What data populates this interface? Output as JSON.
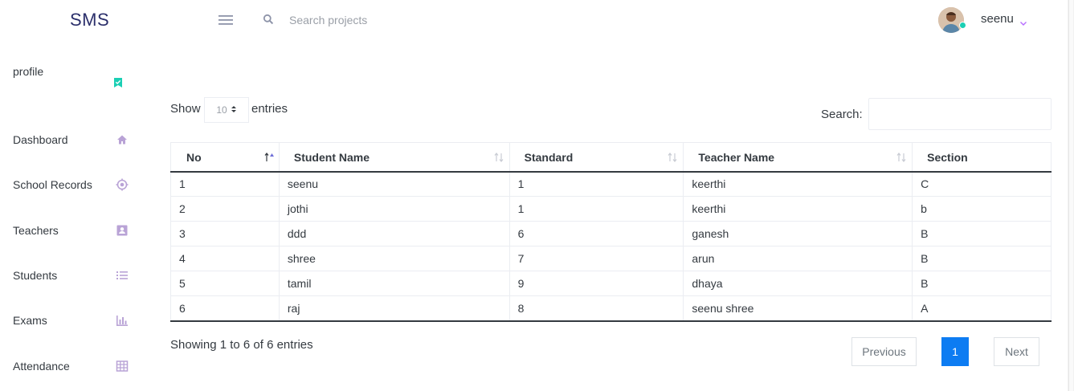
{
  "sidebar": {
    "brand": "SMS",
    "profile": "profile",
    "items": [
      {
        "label": "Dashboard",
        "icon": "home-icon"
      },
      {
        "label": "School Records",
        "icon": "crosshair-icon"
      },
      {
        "label": "Teachers",
        "icon": "contact-card-icon"
      },
      {
        "label": "Students",
        "icon": "list-icon"
      },
      {
        "label": "Exams",
        "icon": "bar-chart-icon"
      },
      {
        "label": "Attendance",
        "icon": "grid-table-icon"
      }
    ]
  },
  "navbar": {
    "search_placeholder": "Search projects",
    "username": "seenu"
  },
  "datatable": {
    "show_label": "Show",
    "length_value": "10",
    "entries_label": "entries",
    "search_label": "Search:",
    "search_value": "",
    "columns": [
      "No",
      "Student Name",
      "Standard",
      "Teacher Name",
      "Section"
    ],
    "rows": [
      [
        "1",
        "seenu",
        "1",
        "keerthi",
        "C"
      ],
      [
        "2",
        "jothi",
        "1",
        "keerthi",
        "b"
      ],
      [
        "3",
        "ddd",
        "6",
        "ganesh",
        "B"
      ],
      [
        "4",
        "shree",
        "7",
        "arun",
        "B"
      ],
      [
        "5",
        "tamil",
        "9",
        "dhaya",
        "B"
      ],
      [
        "6",
        "raj",
        "8",
        "seenu shree",
        "A"
      ]
    ],
    "info": "Showing 1 to 6 of 6 entries",
    "pagination": {
      "previous": "Previous",
      "current": "1",
      "next": "Next"
    }
  },
  "colors": {
    "brand": "#2b2f6b",
    "profile_icon": "#1bcfb4",
    "nav_icon": "#b66dff",
    "page_active": "#0d7cf2"
  }
}
